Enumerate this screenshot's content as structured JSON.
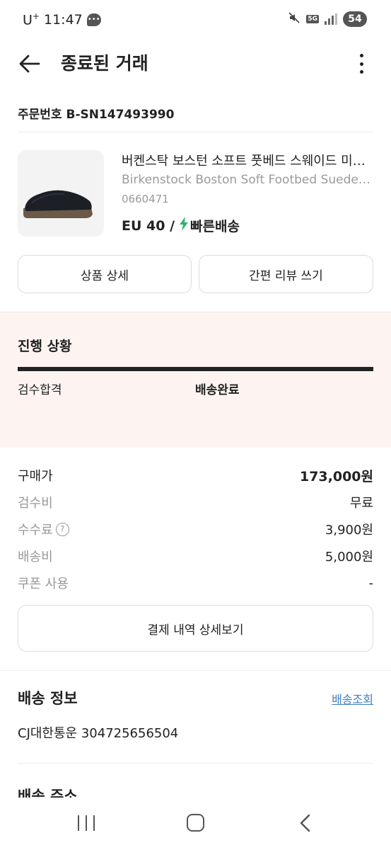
{
  "status_bar": {
    "carrier": "U",
    "carrier_sup": "+",
    "time": "11:47",
    "network": "5G",
    "battery": "54"
  },
  "header": {
    "title": "종료된 거래"
  },
  "order": {
    "label": "주문번호",
    "number": "B-SN147493990"
  },
  "product": {
    "name_ko": "버켄스탁 보스턴 소프트 풋베드 스웨이드 미드나잇",
    "name_en": "Birkenstock Boston Soft Footbed Suede Midnight",
    "code": "0660471",
    "size": "EU 40 /",
    "shipping_type": "빠른배송",
    "detail_button": "상품 상세",
    "review_button": "간편 리뷰 쓰기"
  },
  "progress": {
    "title": "진행 상황",
    "step1": "검수합격",
    "step2": "배송완료",
    "completion": 1.0
  },
  "price": {
    "rows": [
      {
        "label": "구매가",
        "value": "173,000원"
      },
      {
        "label": "검수비",
        "value": "무료"
      },
      {
        "label": "수수료",
        "value": "3,900원"
      },
      {
        "label": "배송비",
        "value": "5,000원"
      },
      {
        "label": "쿠폰 사용",
        "value": "-"
      }
    ],
    "help_symbol": "?",
    "payment_button": "결제 내역 상세보기"
  },
  "shipping": {
    "title": "배송 정보",
    "track_link": "배송조회",
    "carrier_info": "CJ대한통운 304725656504",
    "address_title": "배송 주소"
  },
  "colors": {
    "progress_bg": "#fdf4f1",
    "fast_ship_green": "#31b46e",
    "link_blue": "#3f7fbf"
  },
  "icons": [
    "back-arrow-icon",
    "more-vertical-icon",
    "lightning-icon",
    "question-circle-icon",
    "nav-recent-icon",
    "nav-home-icon",
    "nav-back-icon"
  ]
}
